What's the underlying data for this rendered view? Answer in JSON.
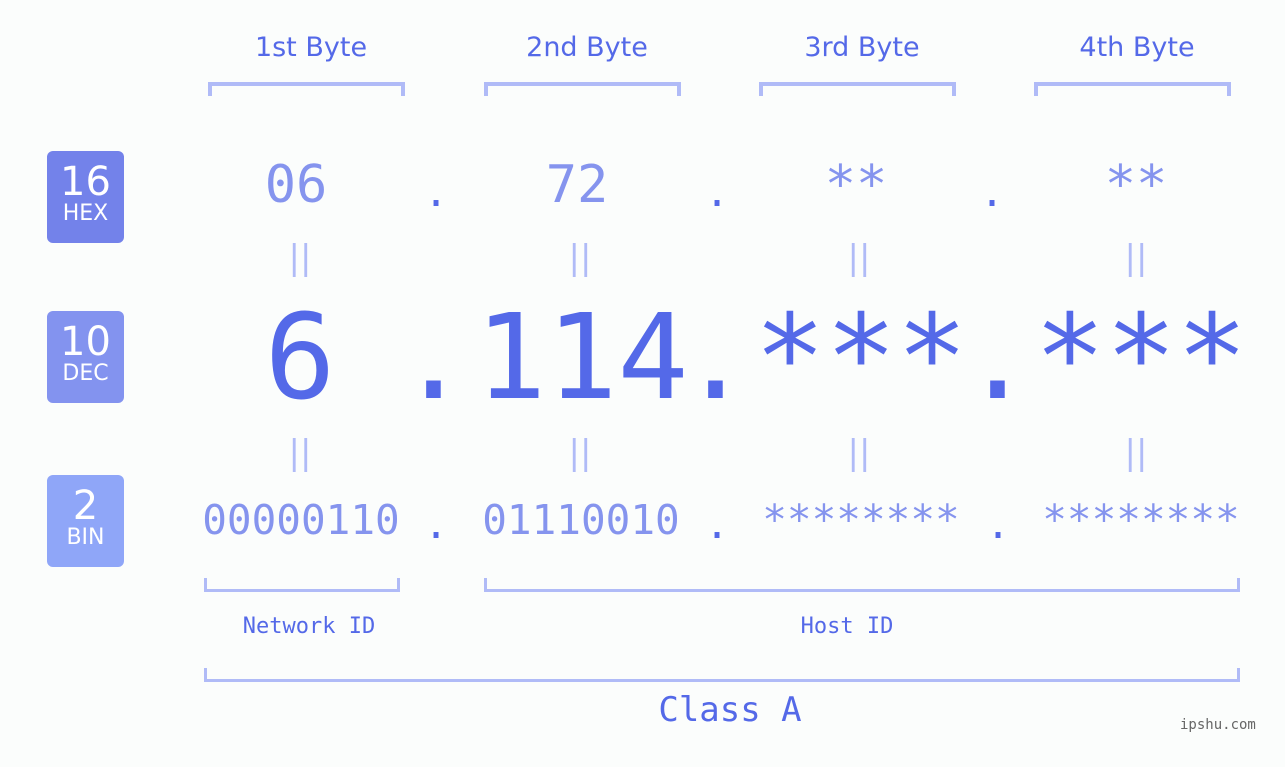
{
  "byte_headers": [
    "1st Byte",
    "2nd Byte",
    "3rd Byte",
    "4th Byte"
  ],
  "bases": [
    {
      "num": "16",
      "name": "HEX",
      "color": "#7382ea"
    },
    {
      "num": "10",
      "name": "DEC",
      "color": "#8393ef"
    },
    {
      "num": "2",
      "name": "BIN",
      "color": "#8fa6f8"
    }
  ],
  "hex": [
    "06",
    "72",
    "**",
    "**"
  ],
  "dec": [
    "6",
    "114",
    "***",
    "***"
  ],
  "bin": [
    "00000110",
    "01110010",
    "********",
    "********"
  ],
  "separator": ".",
  "equals": "||",
  "network_id_label": "Network ID",
  "host_id_label": "Host ID",
  "class_label": "Class A",
  "watermark": "ipshu.com",
  "colors": {
    "accent": "#5469e8",
    "light": "#8594ee",
    "bracket": "#b0bbf7",
    "background": "#fbfdfc"
  }
}
